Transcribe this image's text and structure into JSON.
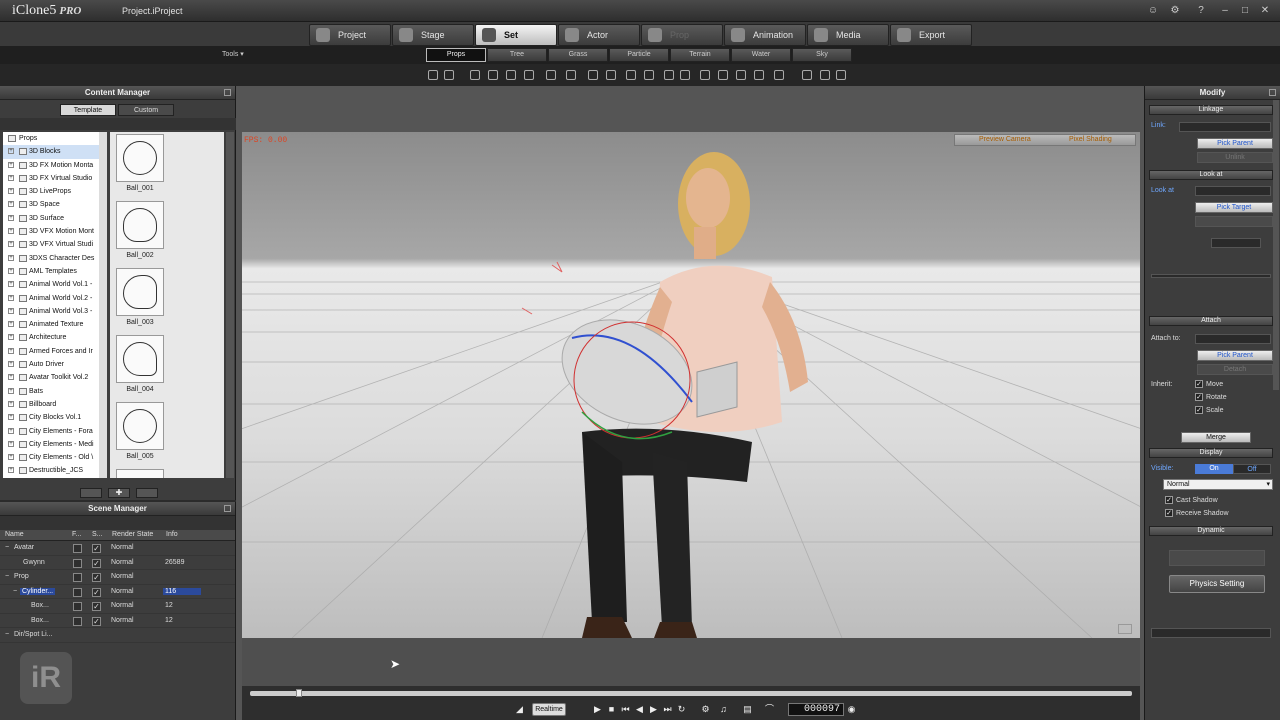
{
  "window": {
    "app_name": "iClone",
    "app_version": "5",
    "edition": "PRO",
    "project": "Project.iProject"
  },
  "main_tabs": [
    {
      "label": "Project",
      "state": "normal"
    },
    {
      "label": "Stage",
      "state": "normal"
    },
    {
      "label": "Set",
      "state": "active"
    },
    {
      "label": "Actor",
      "state": "normal"
    },
    {
      "label": "Prop",
      "state": "disabled"
    },
    {
      "label": "Animation",
      "state": "normal"
    },
    {
      "label": "Media",
      "state": "normal"
    },
    {
      "label": "Export",
      "state": "normal"
    }
  ],
  "tools_menu": "Tools ▾",
  "sub_tabs": [
    {
      "label": "Props",
      "active": true
    },
    {
      "label": "Tree",
      "active": false
    },
    {
      "label": "Grass",
      "active": false
    },
    {
      "label": "Particle",
      "active": false
    },
    {
      "label": "Terrain",
      "active": false
    },
    {
      "label": "Water",
      "active": false
    },
    {
      "label": "Sky",
      "active": false
    }
  ],
  "content_manager": {
    "title": "Content Manager",
    "tabs": [
      "Template",
      "Custom"
    ],
    "tree_root": "Props",
    "tree_items": [
      "3D Blocks",
      "3D FX Motion Monta",
      "3D FX Virtual Studio",
      "3D LiveProps",
      "3D Space",
      "3D Surface",
      "3D VFX Motion Mont",
      "3D VFX Virtual Studi",
      "3DXS Character Des",
      "AML Templates",
      "Animal World Vol.1 -",
      "Animal World Vol.2 -",
      "Animal World Vol.3 -",
      "Animated Texture",
      "Architecture",
      "Armed Forces and Ir",
      "Auto Driver",
      "Avatar Toolkit Vol.2",
      "Bats",
      "Billboard",
      "City Blocks Vol.1",
      "City Elements - Fora",
      "City Elements - Medi",
      "City Elements - Old \\",
      "Destructible_JCS"
    ],
    "thumbnails": [
      "Ball_001",
      "Ball_002",
      "Ball_003",
      "Ball_004",
      "Ball_005"
    ]
  },
  "scene_manager": {
    "title": "Scene Manager",
    "columns": [
      "Name",
      "F...",
      "S...",
      "Render State",
      "Info"
    ],
    "rows": [
      {
        "name": "Avatar",
        "indent": 0,
        "group": true,
        "visible": true,
        "render": "Normal",
        "info": ""
      },
      {
        "name": "Gwynn",
        "indent": 2,
        "group": false,
        "visible": true,
        "render": "Normal",
        "info": "26589"
      },
      {
        "name": "Prop",
        "indent": 0,
        "group": true,
        "visible": true,
        "render": "Normal",
        "info": ""
      },
      {
        "name": "Cylinder...",
        "indent": 1,
        "group": true,
        "visible": true,
        "render": "Normal",
        "info": "116",
        "selected": true
      },
      {
        "name": "Box...",
        "indent": 3,
        "group": false,
        "visible": true,
        "render": "Normal",
        "info": "12"
      },
      {
        "name": "Box...",
        "indent": 3,
        "group": false,
        "visible": true,
        "render": "Normal",
        "info": "12"
      },
      {
        "name": "Dir/Spot Li...",
        "indent": 0,
        "group": true,
        "visible": false,
        "render": "",
        "info": ""
      }
    ]
  },
  "viewport": {
    "fps": "FPS: 0.00",
    "camera": "Preview Camera",
    "shading": "Pixel Shading"
  },
  "timeline": {
    "realtime": "Realtime",
    "frame": "000097",
    "progress": 0.055
  },
  "modify": {
    "title": "Modify",
    "linkage_head": "Linkage",
    "link_label": "Link:",
    "pick_parent": "Pick Parent",
    "unlink": "Unlink",
    "lookat_head": "Look at",
    "lookat_label": "Look at",
    "pick_target": "Pick Target",
    "attach_head": "Attach",
    "attach_label": "Attach to:",
    "pick_parent2": "Pick Parent",
    "detach": "Detach",
    "inherit_label": "Inherit:",
    "inherit": [
      "Move",
      "Rotate",
      "Scale"
    ],
    "merge": "Merge",
    "display_head": "Display",
    "visible_label": "Visible:",
    "on": "On",
    "off": "Off",
    "render_mode": "Normal",
    "cast_shadow": "Cast Shadow",
    "receive_shadow": "Receive Shadow",
    "dynamic_head": "Dynamic",
    "physics_setting": "Physics Setting"
  },
  "colors": {
    "accent_blue": "#4a7bd8",
    "label_blue": "#6fa8ff",
    "fps_red": "#dd4422",
    "selection": "#2b4a9c"
  }
}
